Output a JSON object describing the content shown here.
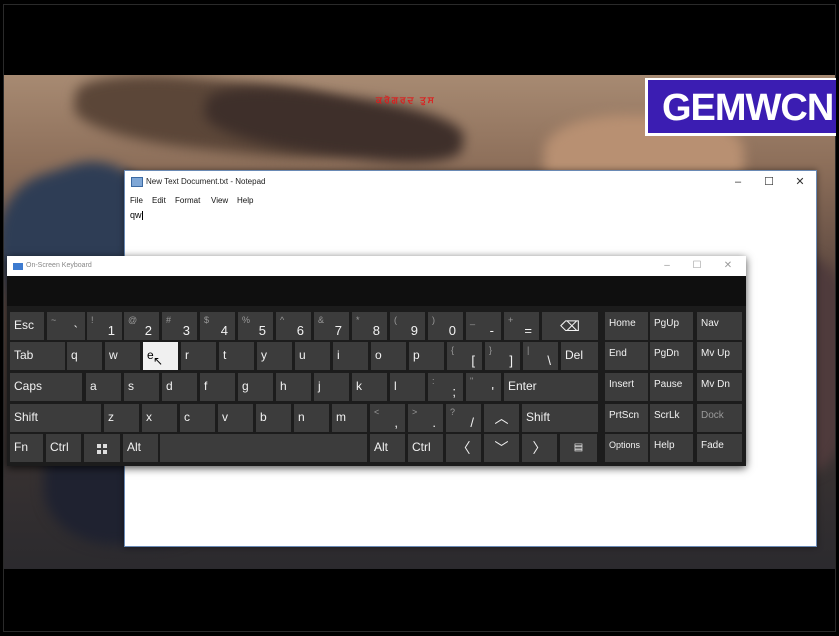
{
  "overlay": {
    "red_text": "ਕਰੋਗਰਦ ਤੁਸ",
    "logo": "GEMWCN"
  },
  "notepad": {
    "title": "New Text Document.txt - Notepad",
    "controls": [
      "–",
      "☐",
      "✕"
    ],
    "menu": [
      "File",
      "Edit",
      "Format",
      "View",
      "Help"
    ],
    "content": "qw"
  },
  "osk": {
    "title": "On-Screen Keyboard",
    "controls": [
      "–",
      "☐",
      "✕"
    ],
    "rows": [
      [
        {
          "name": "esc",
          "label": "Esc"
        },
        {
          "name": "backtick",
          "shift": "~",
          "base": "`"
        },
        {
          "name": "1",
          "shift": "!",
          "base": "1"
        },
        {
          "name": "2",
          "shift": "@",
          "base": "2"
        },
        {
          "name": "3",
          "shift": "#",
          "base": "3"
        },
        {
          "name": "4",
          "shift": "$",
          "base": "4"
        },
        {
          "name": "5",
          "shift": "%",
          "base": "5"
        },
        {
          "name": "6",
          "shift": "^",
          "base": "6"
        },
        {
          "name": "7",
          "shift": "&",
          "base": "7"
        },
        {
          "name": "8",
          "shift": "*",
          "base": "8"
        },
        {
          "name": "9",
          "shift": "(",
          "base": "9"
        },
        {
          "name": "0",
          "shift": ")",
          "base": "0"
        },
        {
          "name": "minus",
          "shift": "_",
          "base": "-"
        },
        {
          "name": "equals",
          "shift": "+",
          "base": "="
        },
        {
          "name": "backspace",
          "icon": "⌫"
        },
        {
          "name": "home",
          "label": "Home"
        },
        {
          "name": "pgup",
          "label": "PgUp"
        },
        {
          "name": "nav",
          "label": "Nav"
        }
      ],
      [
        {
          "name": "tab",
          "label": "Tab"
        },
        {
          "name": "q",
          "label": "q"
        },
        {
          "name": "w",
          "label": "w"
        },
        {
          "name": "e",
          "label": "e"
        },
        {
          "name": "r",
          "label": "r"
        },
        {
          "name": "t",
          "label": "t"
        },
        {
          "name": "y",
          "label": "y"
        },
        {
          "name": "u",
          "label": "u"
        },
        {
          "name": "i",
          "label": "i"
        },
        {
          "name": "o",
          "label": "o"
        },
        {
          "name": "p",
          "label": "p"
        },
        {
          "name": "lbracket",
          "shift": "{",
          "base": "["
        },
        {
          "name": "rbracket",
          "shift": "}",
          "base": "]"
        },
        {
          "name": "backslash",
          "shift": "|",
          "base": "\\"
        },
        {
          "name": "del",
          "label": "Del"
        },
        {
          "name": "end",
          "label": "End"
        },
        {
          "name": "pgdn",
          "label": "PgDn"
        },
        {
          "name": "mvup",
          "label": "Mv Up"
        }
      ],
      [
        {
          "name": "caps",
          "label": "Caps"
        },
        {
          "name": "a",
          "label": "a"
        },
        {
          "name": "s",
          "label": "s"
        },
        {
          "name": "d",
          "label": "d"
        },
        {
          "name": "f",
          "label": "f"
        },
        {
          "name": "g",
          "label": "g"
        },
        {
          "name": "h",
          "label": "h"
        },
        {
          "name": "j",
          "label": "j"
        },
        {
          "name": "k",
          "label": "k"
        },
        {
          "name": "l",
          "label": "l"
        },
        {
          "name": "semicolon",
          "shift": ":",
          "base": ";"
        },
        {
          "name": "quote",
          "shift": "\"",
          "base": "'"
        },
        {
          "name": "enter",
          "label": "Enter"
        },
        {
          "name": "insert",
          "label": "Insert"
        },
        {
          "name": "pause",
          "label": "Pause"
        },
        {
          "name": "mvdn",
          "label": "Mv Dn"
        }
      ],
      [
        {
          "name": "shift-left",
          "label": "Shift"
        },
        {
          "name": "z",
          "label": "z"
        },
        {
          "name": "x",
          "label": "x"
        },
        {
          "name": "c",
          "label": "c"
        },
        {
          "name": "v",
          "label": "v"
        },
        {
          "name": "b",
          "label": "b"
        },
        {
          "name": "n",
          "label": "n"
        },
        {
          "name": "m",
          "label": "m"
        },
        {
          "name": "comma",
          "shift": "<",
          "base": ","
        },
        {
          "name": "period",
          "shift": ">",
          "base": "."
        },
        {
          "name": "slash",
          "shift": "?",
          "base": "/"
        },
        {
          "name": "up",
          "icon": "︿"
        },
        {
          "name": "shift-right",
          "label": "Shift"
        },
        {
          "name": "prtscn",
          "label": "PrtScn"
        },
        {
          "name": "scrlk",
          "label": "ScrLk"
        },
        {
          "name": "dock",
          "label": "Dock"
        }
      ],
      [
        {
          "name": "fn",
          "label": "Fn"
        },
        {
          "name": "ctrl-left",
          "label": "Ctrl"
        },
        {
          "name": "win",
          "icon": "win"
        },
        {
          "name": "alt-left",
          "label": "Alt"
        },
        {
          "name": "space",
          "label": ""
        },
        {
          "name": "alt-right",
          "label": "Alt"
        },
        {
          "name": "ctrl-right",
          "label": "Ctrl"
        },
        {
          "name": "left",
          "icon": "〈"
        },
        {
          "name": "down",
          "icon": "﹀"
        },
        {
          "name": "right",
          "icon": "〉"
        },
        {
          "name": "menu",
          "icon": "▤"
        },
        {
          "name": "options",
          "label": "Options"
        },
        {
          "name": "help",
          "label": "Help"
        },
        {
          "name": "fade",
          "label": "Fade"
        }
      ]
    ]
  }
}
